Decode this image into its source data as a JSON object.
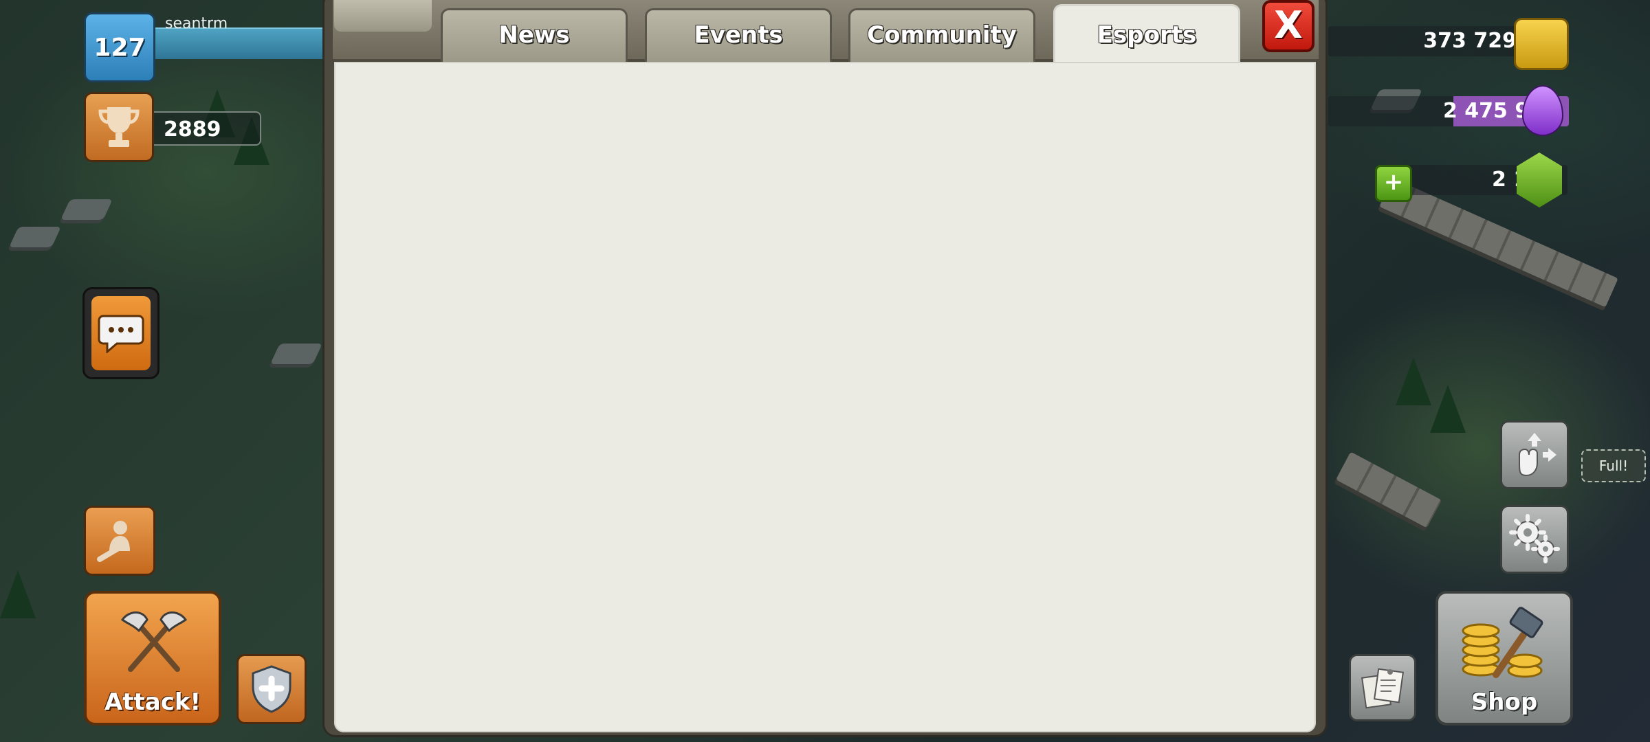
{
  "player": {
    "name": "seantrm",
    "level": "127",
    "trophies": "2889"
  },
  "resources": {
    "gold": "373 729",
    "elixir": "2 475 951",
    "gems": "2 189",
    "gem_add_symbol": "+"
  },
  "modal": {
    "tabs": [
      {
        "label": "News"
      },
      {
        "label": "Events"
      },
      {
        "label": "Community"
      },
      {
        "label": "Esports"
      }
    ],
    "active_tab": "Esports",
    "close_label": "X"
  },
  "buttons": {
    "attack_label": "Attack!",
    "shop_label": "Shop"
  },
  "status": {
    "full_label": "Full!"
  },
  "icons": {
    "level": "star-badge-icon",
    "trophy": "trophy-icon",
    "chat": "chat-bubble-icon",
    "builder": "builder-icon",
    "attack": "crossed-axes-icon",
    "shield": "shield-plus-icon",
    "gold": "gold-icon",
    "elixir": "elixir-drop-icon",
    "gem": "gem-icon",
    "move": "move-hand-icon",
    "settings": "gear-icon",
    "notes": "notes-icon",
    "shop": "hammer-coins-icon"
  },
  "colors": {
    "active_tab_bg": "#ebebe3",
    "close_button": "#e0291b",
    "attack_button": "#e08a3c",
    "xp_bar": "#3f8fb0"
  }
}
